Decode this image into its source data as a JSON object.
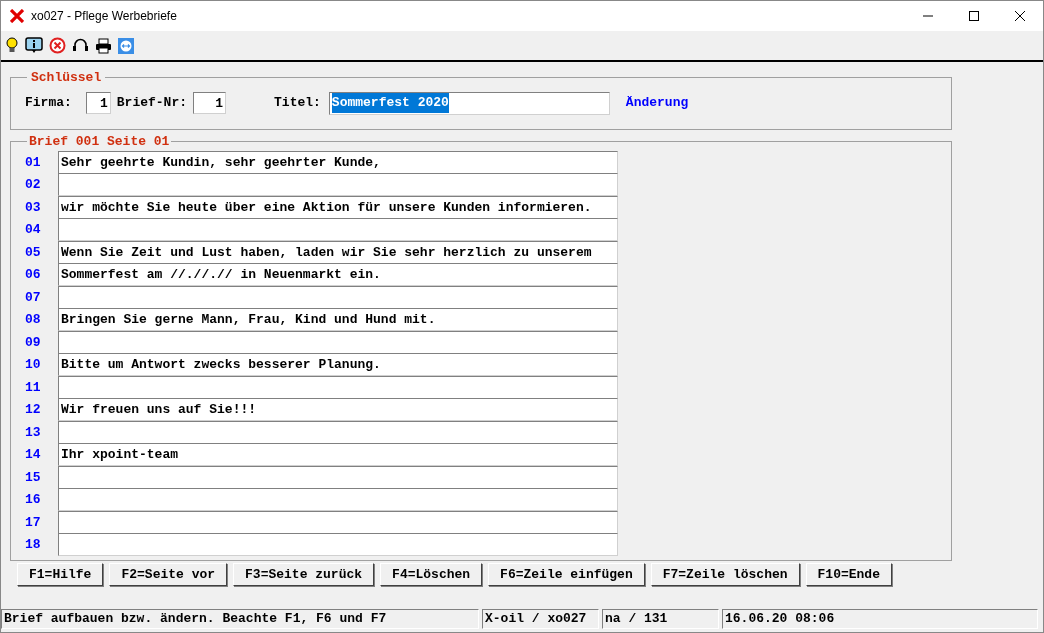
{
  "window": {
    "title": "xo027 - Pflege Werbebriefe"
  },
  "key_section": {
    "legend": "Schlüssel",
    "firma_label": "Firma:",
    "firma_value": "1",
    "brief_nr_label": "Brief-Nr:",
    "brief_nr_value": "1",
    "titel_label": "Titel:",
    "titel_value": "Sommerfest 2020",
    "mode": "Änderung"
  },
  "letter_section": {
    "legend": "Brief 001 Seite 01",
    "lines": [
      {
        "number": "01",
        "text": "Sehr geehrte Kundin, sehr geehrter Kunde,"
      },
      {
        "number": "02"
      },
      {
        "number": "03",
        "text": "wir möchte Sie heute über eine Aktion für unsere Kunden informieren."
      },
      {
        "number": "04"
      },
      {
        "number": "05",
        "text": "Wenn Sie Zeit und Lust haben, laden wir Sie sehr herzlich zu unserem"
      },
      {
        "number": "06",
        "text": "Sommerfest am //.//.// in Neuenmarkt ein."
      },
      {
        "number": "07"
      },
      {
        "number": "08",
        "text": "Bringen Sie gerne Mann, Frau, Kind und Hund mit."
      },
      {
        "number": "09"
      },
      {
        "number": "10",
        "text": "Bitte um Antwort zwecks besserer Planung."
      },
      {
        "number": "11"
      },
      {
        "number": "12",
        "text": "Wir freuen uns auf Sie!!!"
      },
      {
        "number": "13"
      },
      {
        "number": "14",
        "text": "Ihr xpoint-team"
      },
      {
        "number": "15"
      },
      {
        "number": "16"
      },
      {
        "number": "17"
      },
      {
        "number": "18"
      }
    ]
  },
  "buttons": [
    "F1=Hilfe",
    "F2=Seite vor",
    "F3=Seite zurück",
    "F4=Löschen",
    "F6=Zeile einfügen",
    "F7=Zeile löschen",
    "F10=Ende"
  ],
  "status_bar": [
    "Brief aufbauen bzw. ändern. Beachte F1, F6 und F7",
    "X-oil / xo027",
    "na / 131",
    "16.06.20 08:06"
  ]
}
